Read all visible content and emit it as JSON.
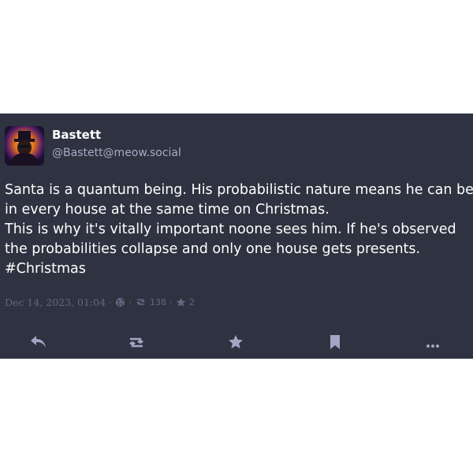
{
  "post": {
    "display_name": "Bastett",
    "handle": "@Bastett@meow.social",
    "content_lines": [
      "Santa is a quantum being. His probabilistic nature means he can be",
      "in every house at the same time on Christmas.",
      "This is why it's vitally important noone sees him. If he's observed",
      "the probabilities collapse and only one house gets presents."
    ],
    "hashtag": "#Christmas",
    "timestamp": "Dec 14, 2023, 01:04",
    "separator": "·",
    "boost_count": "138",
    "favourite_count": "2"
  },
  "icons": {
    "visibility": "globe-icon",
    "boost": "retweet-icon",
    "favourite": "star-icon",
    "reply": "reply-icon",
    "bookmark": "bookmark-icon",
    "more": "ellipsis-icon"
  },
  "colors": {
    "background": "#2f3240",
    "text": "#ffffff",
    "secondary_text": "#a7acc6",
    "muted": "#626781",
    "action_icon": "#a0a6c4"
  }
}
